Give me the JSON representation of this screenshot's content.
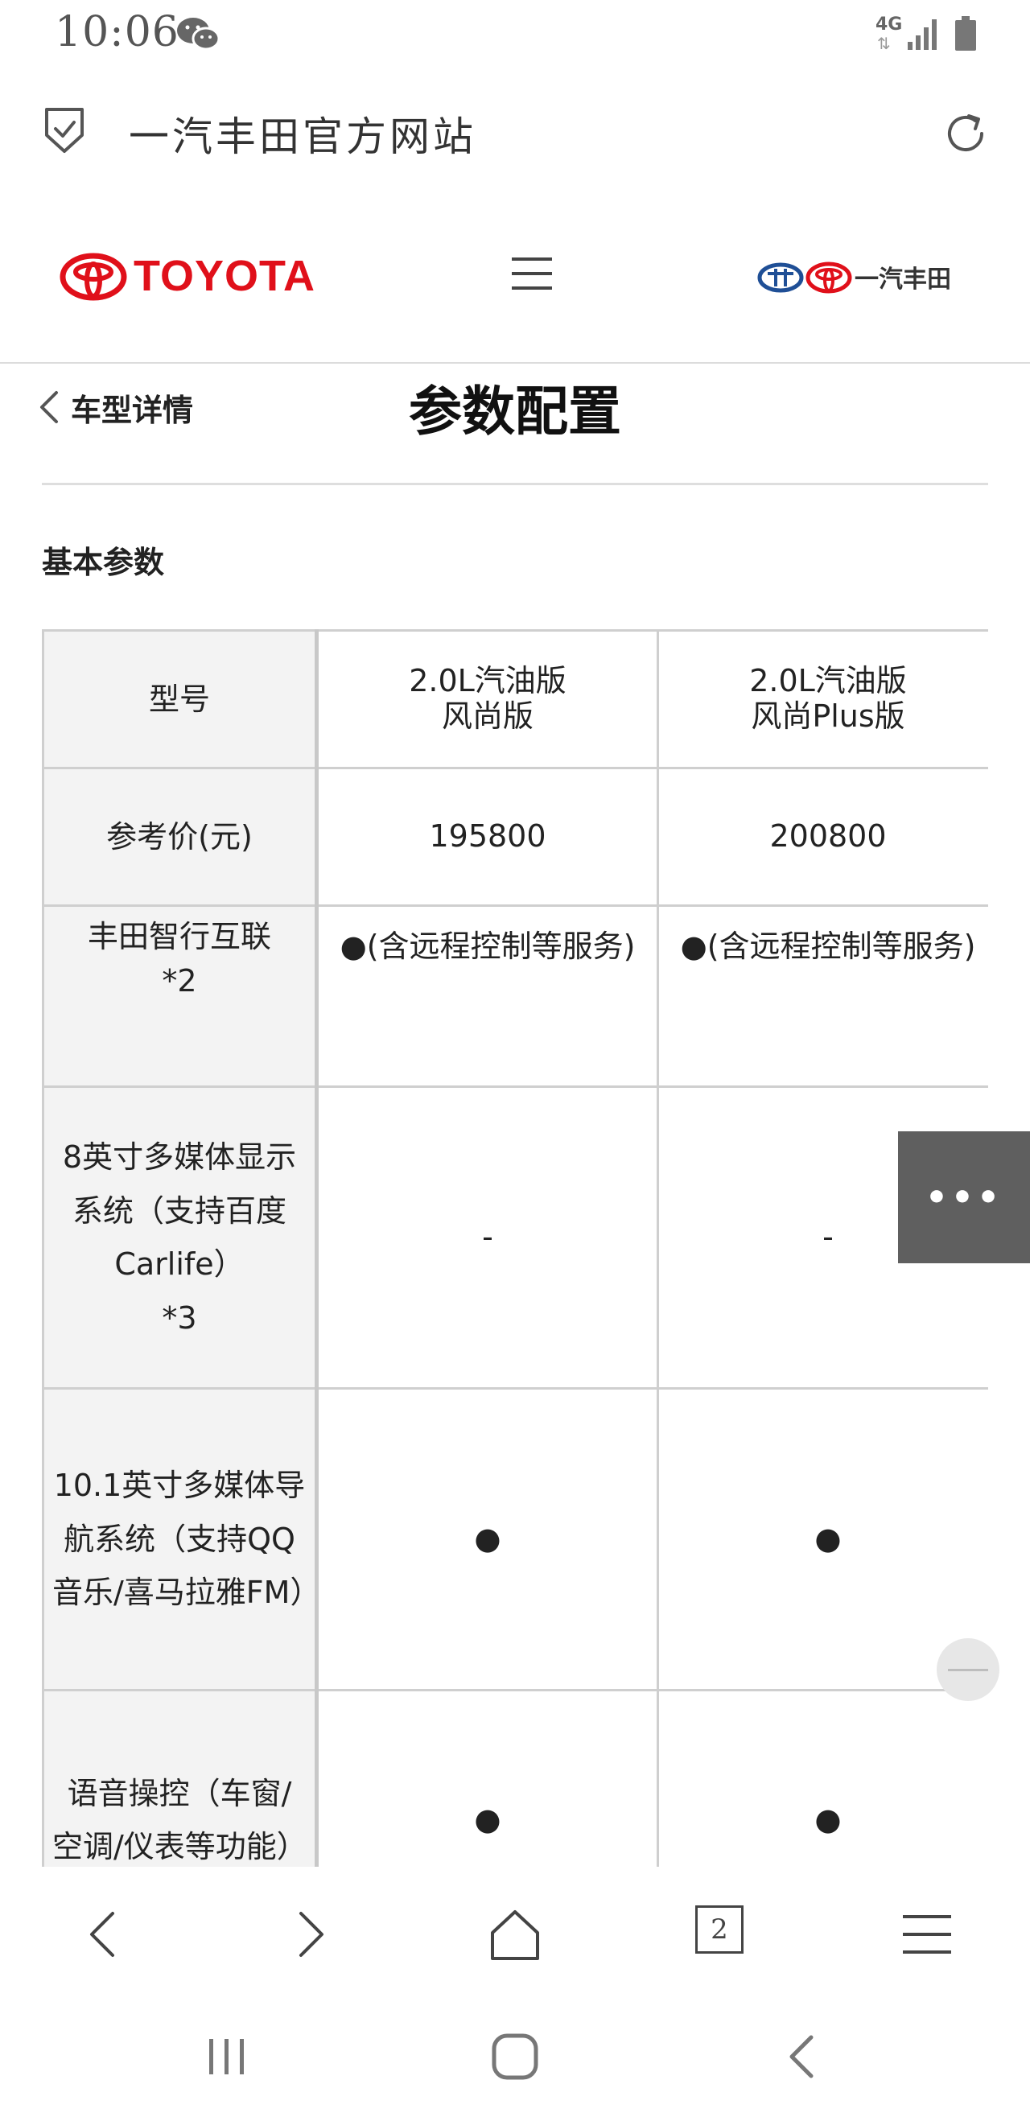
{
  "status_bar": {
    "time": "10:06",
    "network": "4G"
  },
  "address_bar": {
    "site_title": "一汽丰田官方网站"
  },
  "header": {
    "brand_wordmark": "TOYOTA",
    "partner_logo_text": "一汽丰田",
    "brand_color": "#e0101a"
  },
  "page": {
    "back_label": "车型详情",
    "title": "参数配置",
    "section_title": "基本参数"
  },
  "spec_table": {
    "rows": [
      {
        "label": "型号",
        "values": [
          "2.0L汽油版\n风尚版",
          "2.0L汽油版\n风尚Plus版"
        ]
      },
      {
        "label": "参考价(元)",
        "values": [
          "195800",
          "200800"
        ]
      },
      {
        "label": "丰田智行互联\n*2",
        "values": [
          "●(含远程控制等服务)",
          "●(含远程控制等服务)"
        ]
      },
      {
        "label": "8英寸多媒体显示系统（支持百度Carlife）\n*3",
        "values": [
          "-",
          "-"
        ]
      },
      {
        "label": "10.1英寸多媒体导航系统（支持QQ音乐/喜马拉雅FM）",
        "values": [
          "●",
          "●"
        ]
      },
      {
        "label": "语音操控（车窗/空调/仪表等功能）",
        "values": [
          "●",
          "●"
        ]
      }
    ]
  },
  "floating": {
    "more_label": "•••"
  },
  "toolbar": {
    "tab_count": "2"
  }
}
